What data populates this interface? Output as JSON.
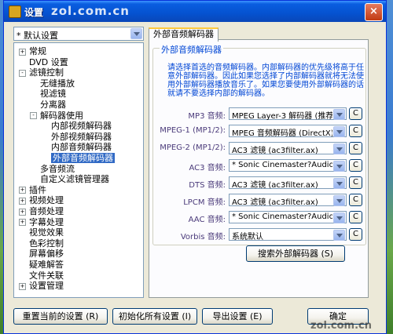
{
  "window": {
    "title": "设置",
    "watermark_top": "zol.com.cn",
    "watermark_bottom": "zol.com.cn",
    "close_label": "×"
  },
  "left": {
    "profile_combo": "* 默认设置",
    "tree": [
      {
        "label": "常规",
        "expander": "+",
        "level": 0
      },
      {
        "label": "DVD 设置",
        "expander": "",
        "level": 0
      },
      {
        "label": "滤镜控制",
        "expander": "-",
        "level": 0
      },
      {
        "label": "无缝播放",
        "expander": "",
        "level": 1
      },
      {
        "label": "视滤镜",
        "expander": "",
        "level": 1
      },
      {
        "label": "分离器",
        "expander": "",
        "level": 1
      },
      {
        "label": "解码器使用",
        "expander": "-",
        "level": 1
      },
      {
        "label": "内部视频解码器",
        "expander": "",
        "level": 2
      },
      {
        "label": "外部视频解码器",
        "expander": "",
        "level": 2
      },
      {
        "label": "内部音频解码器",
        "expander": "",
        "level": 2
      },
      {
        "label": "外部音频解码器",
        "expander": "",
        "level": 2,
        "selected": true
      },
      {
        "label": "多音频流",
        "expander": "",
        "level": 1
      },
      {
        "label": "自定义滤镜管理器",
        "expander": "",
        "level": 1
      },
      {
        "label": "插件",
        "expander": "+",
        "level": 0
      },
      {
        "label": "视频处理",
        "expander": "+",
        "level": 0
      },
      {
        "label": "音频处理",
        "expander": "+",
        "level": 0
      },
      {
        "label": "字幕处理",
        "expander": "+",
        "level": 0
      },
      {
        "label": "视觉效果",
        "expander": "",
        "level": 0
      },
      {
        "label": "色彩控制",
        "expander": "",
        "level": 0
      },
      {
        "label": "屏幕偏移",
        "expander": "",
        "level": 0
      },
      {
        "label": "疑难解答",
        "expander": "",
        "level": 0
      },
      {
        "label": "文件关联",
        "expander": "",
        "level": 0
      },
      {
        "label": "设置管理",
        "expander": "+",
        "level": 0
      }
    ]
  },
  "right": {
    "tab_label": "外部音频解码器",
    "group_title": "外部音频解码器",
    "description": "请选择首选的音频解码器。内部解码器的优先级将高于任意外部解码器。因此如果您选择了内部解码器就将无法使用外部解码器播放音乐了。如果您要使用外部解码器的话就请不要选择内部的解码器。",
    "rows": [
      {
        "label": "MP3 音频:",
        "value": "MPEG Layer-3 解码器 (推荐)",
        "button": "C"
      },
      {
        "label": "MPEG-1 (MP1/2):",
        "value": "MPEG 音频解码器 (DirectX)",
        "button": "C"
      },
      {
        "label": "MPEG-2 (MP1/2):",
        "value": "AC3 滤镜 (ac3filter.ax)",
        "button": "C"
      },
      {
        "label": "AC3 音频:",
        "value": "* Sonic Cinemaster?Audio Deco",
        "button": "C"
      },
      {
        "label": "DTS 音频:",
        "value": "AC3 滤镜 (ac3filter.ax)",
        "button": "C"
      },
      {
        "label": "LPCM 音频:",
        "value": "AC3 滤镜 (ac3filter.ax)",
        "button": "C"
      },
      {
        "label": "AAC 音频:",
        "value": "* Sonic Cinemaster?Audio Deco",
        "button": "C"
      },
      {
        "label": "Vorbis 音频:",
        "value": "系统默认",
        "button": "C"
      }
    ],
    "search_button": "搜索外部解码器 (S)"
  },
  "bottom": {
    "reset_current": "重置当前的设置 (R)",
    "init_all": "初始化所有设置 (I)",
    "export": "导出设置 (E)",
    "ok": "确定"
  }
}
